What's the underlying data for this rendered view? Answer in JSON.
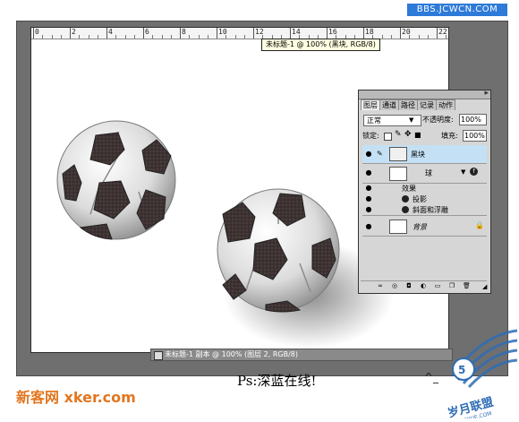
{
  "site_watermark": "BBS.JCWCN.COM",
  "tooltip": "未标题-1 @ 100% (黑块, RGB/8)",
  "ruler": {
    "labels": [
      "0",
      "2",
      "4",
      "6",
      "8",
      "10",
      "12",
      "14",
      "16",
      "18",
      "20",
      "22"
    ]
  },
  "document": {
    "title": "未标题-1 副本 @ 100% (图层 2, RGB/8)"
  },
  "layers_panel": {
    "tabs": [
      "图层",
      "通道",
      "路径",
      "记录",
      "动作"
    ],
    "blend_mode": "正常",
    "opacity_label": "不透明度:",
    "opacity_value": "100%",
    "lock_label": "锁定:",
    "fill_label": "填充:",
    "fill_value": "100%",
    "layers": [
      {
        "name": "黑块"
      },
      {
        "name": "球"
      },
      {
        "name": "效果"
      },
      {
        "name": "投影"
      },
      {
        "name": "斜面和浮雕"
      },
      {
        "name": "背景"
      }
    ]
  },
  "caption": "Ps:深蓝在线!",
  "emoticon": "^_",
  "watermark_bottom": "新客网 xker.com",
  "logo_text": [
    "岁月联盟",
    "SYUE.COM"
  ],
  "colors": {
    "workspace": "#6f6f6f",
    "selected_layer": "#c4e0f5",
    "watermark_orange": "#e2761f",
    "site_banner": "#2e7ad8",
    "logo_blue": "#2f6db5"
  }
}
